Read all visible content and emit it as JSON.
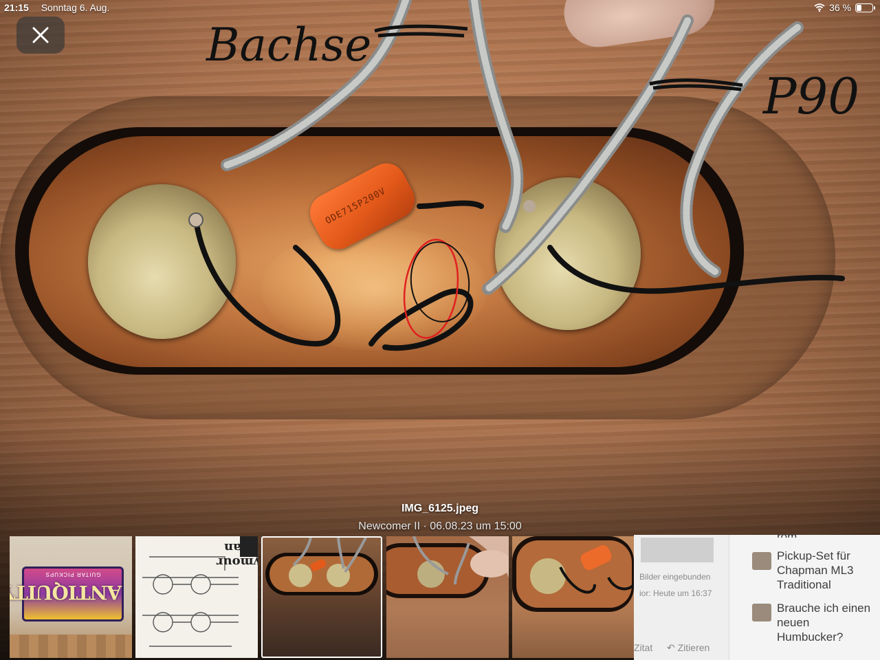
{
  "status_bar": {
    "time": "21:15",
    "date": "Sonntag 6. Aug.",
    "battery": "36 %",
    "battery_level": 0.36
  },
  "photo": {
    "annotations": {
      "handwritten_left": "Bachse",
      "handwritten_right": "P90"
    },
    "capacitor_label": "ODE715P200V"
  },
  "caption": {
    "filename": "IMG_6125.jpeg",
    "subtitle": "Newcomer II · 06.08.23 um 15:00"
  },
  "thumbnails": [
    {
      "brand_text": "ANTIQUITY",
      "sub_text": "GUITAR PICKUPS"
    },
    {
      "brand_text": "Seymour Duncan"
    },
    {
      "selected": true
    },
    {},
    {}
  ],
  "background_page": {
    "embedded_text": "Bilder eingebunden",
    "timestamp_text": "ior: Heute um 16:37",
    "topics": [
      "Pickup-Set für Chapman ML3 Traditional",
      "Brauche ich einen neuen Humbucker?"
    ],
    "top_partial": "rom",
    "actions": {
      "quote": "Zitat",
      "cite": "Zitieren"
    }
  },
  "colors": {
    "accent_red": "#e02020",
    "capacitor_orange": "#e45a1a"
  }
}
